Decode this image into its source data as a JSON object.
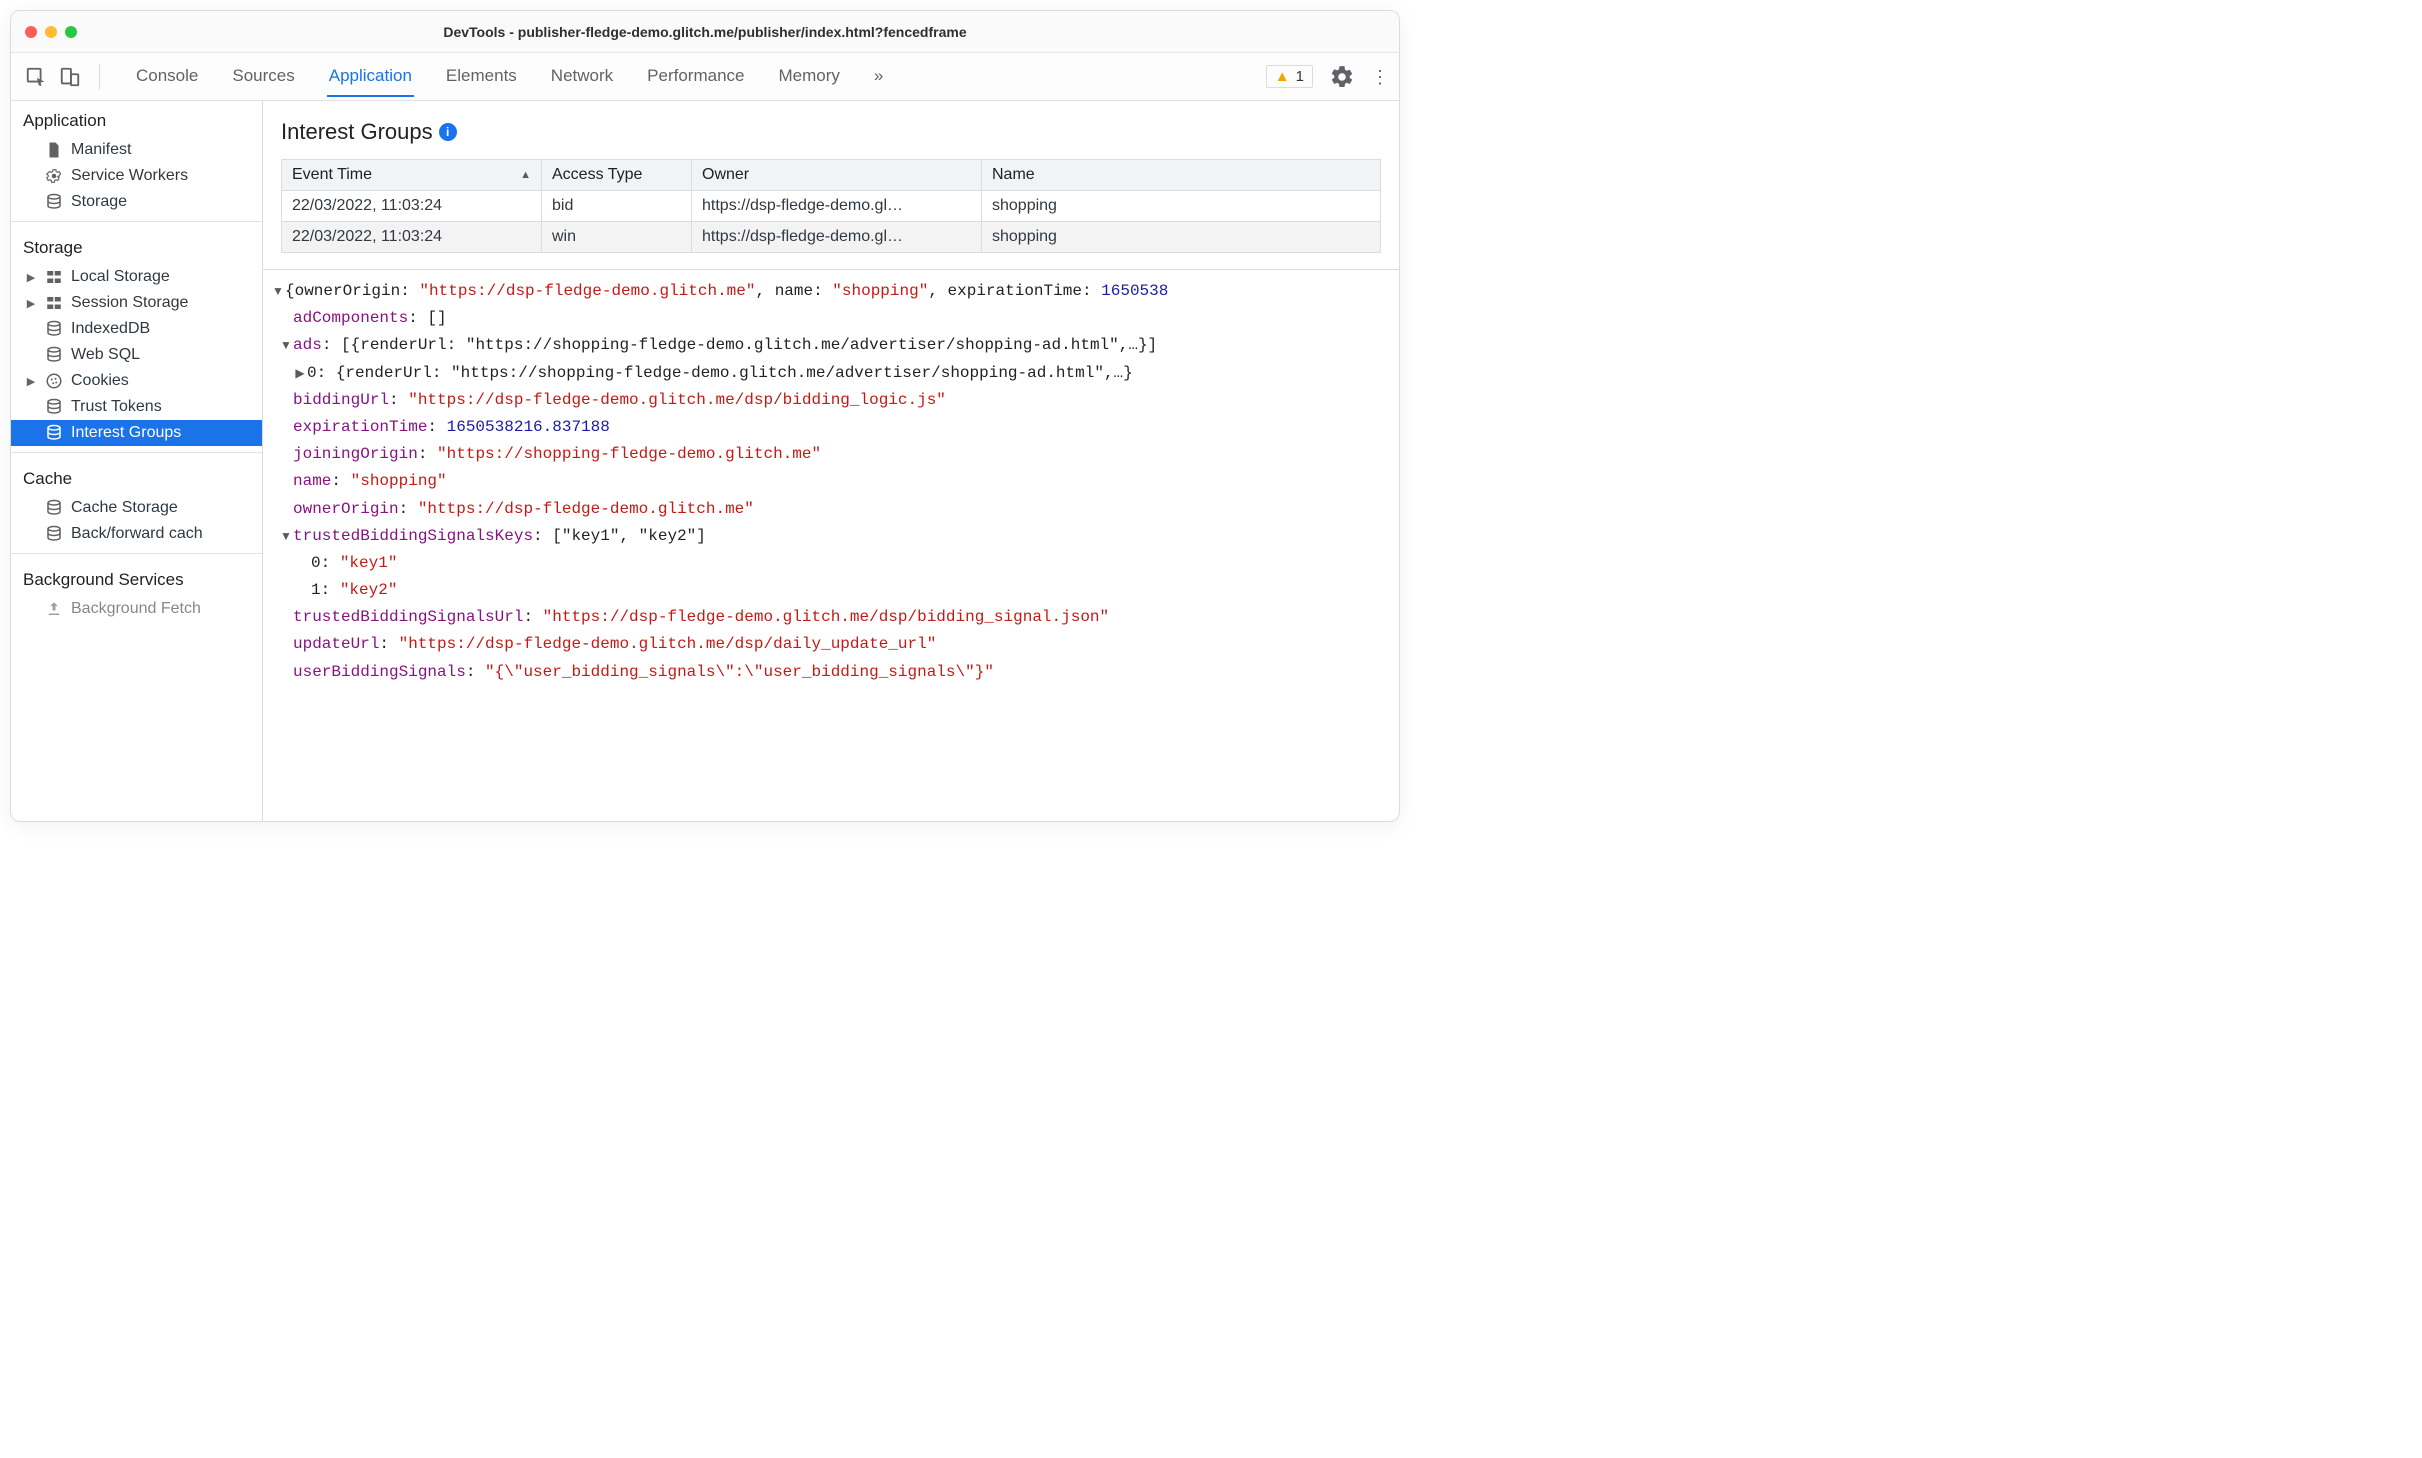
{
  "window": {
    "title": "DevTools - publisher-fledge-demo.glitch.me/publisher/index.html?fencedframe"
  },
  "toolbar": {
    "tabs": [
      "Console",
      "Sources",
      "Application",
      "Elements",
      "Network",
      "Performance",
      "Memory"
    ],
    "active_tab": "Application",
    "more_glyph": "»",
    "warning_count": "1"
  },
  "sidebar": {
    "sections": {
      "application": {
        "title": "Application",
        "items": [
          "Manifest",
          "Service Workers",
          "Storage"
        ]
      },
      "storage": {
        "title": "Storage",
        "items": [
          "Local Storage",
          "Session Storage",
          "IndexedDB",
          "Web SQL",
          "Cookies",
          "Trust Tokens",
          "Interest Groups"
        ]
      },
      "cache": {
        "title": "Cache",
        "items": [
          "Cache Storage",
          "Back/forward cach"
        ]
      },
      "background": {
        "title": "Background Services",
        "items": [
          "Background Fetch"
        ]
      }
    }
  },
  "panel": {
    "title": "Interest Groups",
    "columns": [
      "Event Time",
      "Access Type",
      "Owner",
      "Name"
    ],
    "rows": [
      {
        "time": "22/03/2022, 11:03:24",
        "type": "bid",
        "owner": "https://dsp-fledge-demo.gl…",
        "name": "shopping"
      },
      {
        "time": "22/03/2022, 11:03:24",
        "type": "win",
        "owner": "https://dsp-fledge-demo.gl…",
        "name": "shopping"
      }
    ]
  },
  "detail": {
    "topline_prefix": "{ownerOrigin: ",
    "topline_owner": "\"https://dsp-fledge-demo.glitch.me\"",
    "topline_mid1": ", name: ",
    "topline_name": "\"shopping\"",
    "topline_mid2": ", expirationTime: ",
    "topline_exp": "1650538",
    "adComponents_key": "adComponents",
    "adComponents_val": "[]",
    "ads_key": "ads",
    "ads_inline": "[{renderUrl: \"https://shopping-fledge-demo.glitch.me/advertiser/shopping-ad.html\",…}]",
    "ads_0": "{renderUrl: \"https://shopping-fledge-demo.glitch.me/advertiser/shopping-ad.html\",…}",
    "biddingUrl_key": "biddingUrl",
    "biddingUrl_val": "\"https://dsp-fledge-demo.glitch.me/dsp/bidding_logic.js\"",
    "expirationTime_key": "expirationTime",
    "expirationTime_val": "1650538216.837188",
    "joiningOrigin_key": "joiningOrigin",
    "joiningOrigin_val": "\"https://shopping-fledge-demo.glitch.me\"",
    "name_key": "name",
    "name_val": "\"shopping\"",
    "ownerOrigin_key": "ownerOrigin",
    "ownerOrigin_val": "\"https://dsp-fledge-demo.glitch.me\"",
    "tbsk_key": "trustedBiddingSignalsKeys",
    "tbsk_inline": "[\"key1\", \"key2\"]",
    "tbsk_0": "\"key1\"",
    "tbsk_1": "\"key2\"",
    "tbsu_key": "trustedBiddingSignalsUrl",
    "tbsu_val": "\"https://dsp-fledge-demo.glitch.me/dsp/bidding_signal.json\"",
    "updateUrl_key": "updateUrl",
    "updateUrl_val": "\"https://dsp-fledge-demo.glitch.me/dsp/daily_update_url\"",
    "ubs_key": "userBiddingSignals",
    "ubs_val": "\"{\\\"user_bidding_signals\\\":\\\"user_bidding_signals\\\"}\""
  }
}
